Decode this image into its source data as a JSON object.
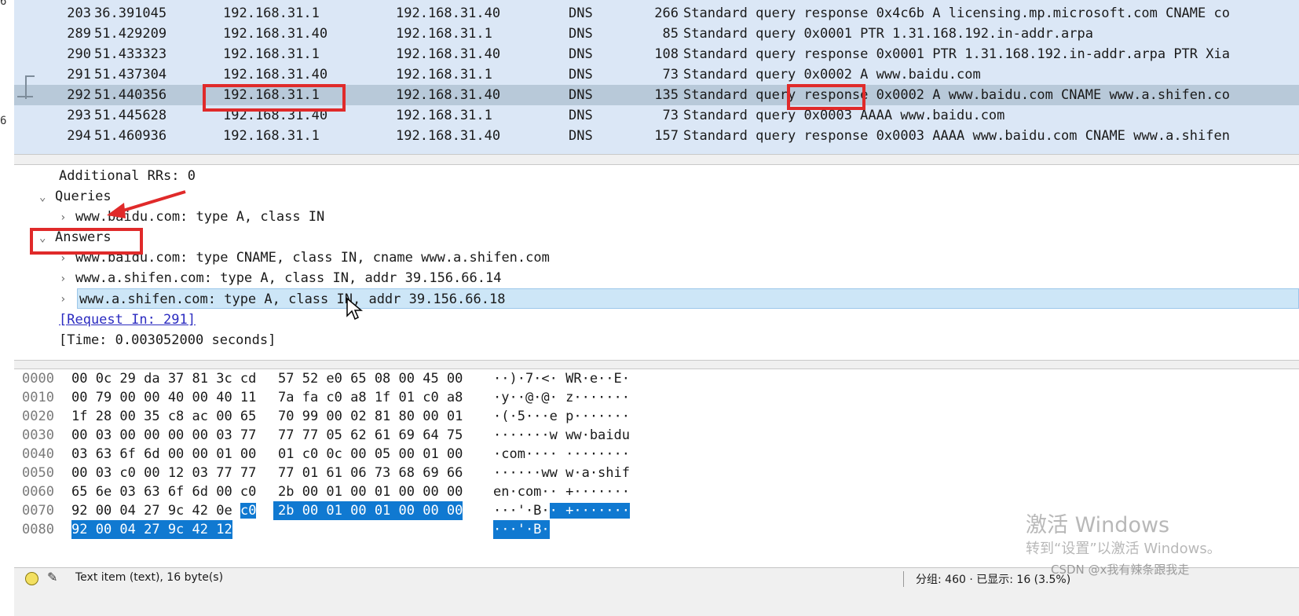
{
  "left_edge_digits": [
    "6",
    "6"
  ],
  "packet_list": {
    "rows": [
      {
        "no": "203",
        "time": "36.391045",
        "src": "192.168.31.1",
        "dst": "192.168.31.40",
        "proto": "DNS",
        "len": "266",
        "info": "Standard query response 0x4c6b A licensing.mp.microsoft.com CNAME co"
      },
      {
        "no": "289",
        "time": "51.429209",
        "src": "192.168.31.40",
        "dst": "192.168.31.1",
        "proto": "DNS",
        "len": "85",
        "info": "Standard query 0x0001 PTR 1.31.168.192.in-addr.arpa"
      },
      {
        "no": "290",
        "time": "51.433323",
        "src": "192.168.31.1",
        "dst": "192.168.31.40",
        "proto": "DNS",
        "len": "108",
        "info": "Standard query response 0x0001 PTR 1.31.168.192.in-addr.arpa PTR Xia"
      },
      {
        "no": "291",
        "time": "51.437304",
        "src": "192.168.31.40",
        "dst": "192.168.31.1",
        "proto": "DNS",
        "len": "73",
        "info": "Standard query 0x0002 A www.baidu.com"
      },
      {
        "no": "292",
        "time": "51.440356",
        "src": "192.168.31.1",
        "dst": "192.168.31.40",
        "proto": "DNS",
        "len": "135",
        "info": "Standard query response 0x0002 A www.baidu.com CNAME www.a.shifen.co"
      },
      {
        "no": "293",
        "time": "51.445628",
        "src": "192.168.31.40",
        "dst": "192.168.31.1",
        "proto": "DNS",
        "len": "73",
        "info": "Standard query 0x0003 AAAA www.baidu.com"
      },
      {
        "no": "294",
        "time": "51.460936",
        "src": "192.168.31.1",
        "dst": "192.168.31.40",
        "proto": "DNS",
        "len": "157",
        "info": "Standard query response 0x0003 AAAA www.baidu.com CNAME www.a.shifen"
      }
    ],
    "selected_row_no": "292"
  },
  "details": {
    "additional_rrs": "Additional RRs: 0",
    "queries_label": "Queries",
    "query_item": "www.baidu.com: type A, class IN",
    "answers_label": "Answers",
    "answers": [
      "www.baidu.com: type CNAME, class IN, cname www.a.shifen.com",
      "www.a.shifen.com: type A, class IN, addr 39.156.66.14",
      "www.a.shifen.com: type A, class IN, addr 39.156.66.18"
    ],
    "request_in": "[Request In: 291]",
    "time": "[Time: 0.003052000 seconds]"
  },
  "bytes": {
    "rows": [
      {
        "off": "0000",
        "h1": "00 0c 29 da 37 81 3c cd",
        "h2": "57 52 e0 65 08 00 45 00",
        "a": "··)·7·<· WR·e··E·"
      },
      {
        "off": "0010",
        "h1": "00 79 00 00 40 00 40 11",
        "h2": "7a fa c0 a8 1f 01 c0 a8",
        "a": "·y··@·@· z·······"
      },
      {
        "off": "0020",
        "h1": "1f 28 00 35 c8 ac 00 65",
        "h2": "70 99 00 02 81 80 00 01",
        "a": "·(·5···e p·······"
      },
      {
        "off": "0030",
        "h1": "00 03 00 00 00 00 03 77",
        "h2": "77 77 05 62 61 69 64 75",
        "a": "·······w ww·baidu"
      },
      {
        "off": "0040",
        "h1": "03 63 6f 6d 00 00 01 00",
        "h2": "01 c0 0c 00 05 00 01 00",
        "a": "·com···· ········"
      },
      {
        "off": "0050",
        "h1": "00 03 c0 00 12 03 77 77",
        "h2": "77 01 61 06 73 68 69 66",
        "a": "······ww w·a·shif"
      },
      {
        "off": "0060",
        "h1": "65 6e 03 63 6f 6d 00 c0",
        "h2": "2b 00 01 00 01 00 00 00",
        "a": "en·com·· +·······"
      },
      {
        "off": "0070",
        "h1": "92 00 04 27 9c 42 0e",
        "h1_sel": "c0",
        "h2": "2b 00 01 00 01 00 00 00",
        "a": "···'·B·",
        "a_sel": "· +·······"
      },
      {
        "off": "0080",
        "h1": "",
        "h1_sel": "92 00 04 27 9c 42 12",
        "h2": "",
        "a": "",
        "a_sel": "···'·B·"
      }
    ]
  },
  "status": {
    "left": "Text item (text), 16 byte(s)",
    "right": "分组: 460 · 已显示: 16 (3.5%)"
  },
  "watermark": {
    "line1": "激活 Windows",
    "line2": "转到“设置”以激活 Windows。",
    "csdn": "CSDN @x我有辣条跟我走"
  },
  "colors": {
    "packet_bg": "#dbe7f6",
    "selected_row": "#b8c9d9",
    "byte_selection": "#1079d1",
    "annotation_red": "#e02a2a"
  }
}
